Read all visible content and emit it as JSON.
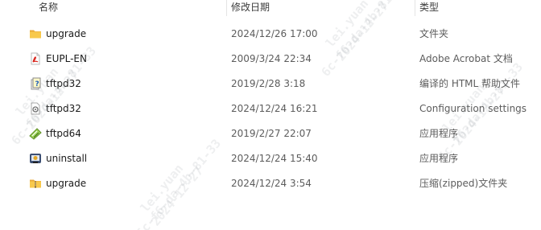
{
  "header": {
    "name": "名称",
    "date": "修改日期",
    "type": "类型"
  },
  "rows": [
    {
      "name": "upgrade",
      "date": "2024/12/26 17:00",
      "type": "文件夹",
      "icon": "folder-icon"
    },
    {
      "name": "EUPL-EN",
      "date": "2009/3/24 22:34",
      "type": "Adobe Acrobat 文档",
      "icon": "pdf-icon"
    },
    {
      "name": "tftpd32",
      "date": "2019/2/28 3:18",
      "type": "编译的 HTML 帮助文件",
      "icon": "help-file-icon"
    },
    {
      "name": "tftpd32",
      "date": "2024/12/24 16:21",
      "type": "Configuration settings",
      "icon": "config-file-icon"
    },
    {
      "name": "tftpd64",
      "date": "2019/2/27 22:07",
      "type": "应用程序",
      "icon": "application-icon"
    },
    {
      "name": "uninstall",
      "date": "2024/12/24 15:40",
      "type": "应用程序",
      "icon": "uninstaller-icon"
    },
    {
      "name": "upgrade",
      "date": "2024/12/24 3:54",
      "type": "压缩(zipped)文件夹",
      "icon": "zip-folder-icon"
    }
  ],
  "watermark": {
    "line1": "6c-f6-da-4b-81-33",
    "line2": "lei.yuan",
    "line3": "2024-12-27"
  }
}
